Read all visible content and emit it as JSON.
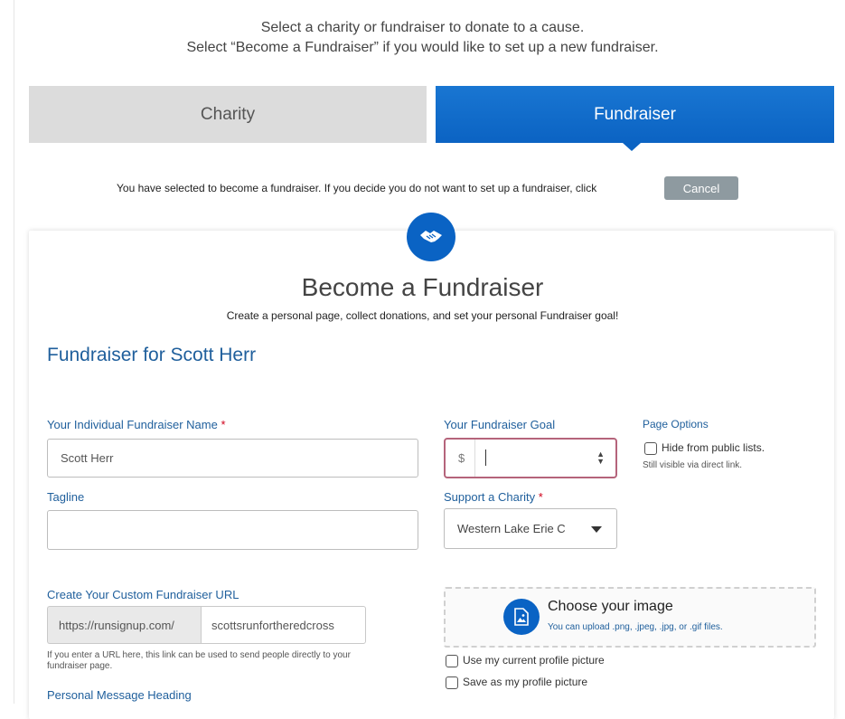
{
  "intro": {
    "line1": "Select a charity or fundraiser to donate to a cause.",
    "line2": "Select “Become a Fundraiser” if you would like to set up a new fundraiser."
  },
  "tabs": [
    {
      "label": "Charity",
      "selected": false
    },
    {
      "label": "Fundraiser",
      "selected": true
    }
  ],
  "notice": {
    "text": "You have selected to become a fundraiser. If you decide you do not want to set up a fundraiser, click",
    "cancel_label": "Cancel"
  },
  "form": {
    "title": "Become a Fundraiser",
    "subtitle": "Create a personal page, collect donations, and set your personal Fundraiser goal!",
    "fundraiser_for": "Fundraiser for Scott Herr",
    "name_label": "Your Individual Fundraiser Name",
    "name_value": "Scott Herr",
    "required_mark": "*",
    "tagline_label": "Tagline",
    "tagline_value": "",
    "goal_label": "Your Fundraiser Goal",
    "goal_currency": "$",
    "goal_value": "",
    "charity_label": "Support a Charity",
    "charity_value": "Western Lake Erie C",
    "page_options_label": "Page Options",
    "hide_label": "Hide from public lists.",
    "hide_note": "Still visible via direct link.",
    "url_label": "Create Your Custom Fundraiser URL",
    "url_prefix": "https://runsignup.com/",
    "url_value": "scottsrunfortheredcross",
    "url_help_line1": "If you enter a URL here, this link can be used to send people directly to your",
    "url_help_line2": "fundraiser page.",
    "message_heading_label": "Personal Message Heading",
    "image_title": "Choose your image",
    "image_sub": "You can upload .png, .jpeg, .jpg, or .gif files.",
    "use_profile_label": "Use my current profile picture",
    "save_profile_label": "Save as my profile picture"
  },
  "colors": {
    "primary": "#0b63c3",
    "label_blue": "#1f5f9c",
    "required_red": "#d0021b",
    "focus_border": "#b5647b"
  },
  "icons": {
    "badge": "handshake-icon",
    "upload": "image-upload-icon"
  }
}
